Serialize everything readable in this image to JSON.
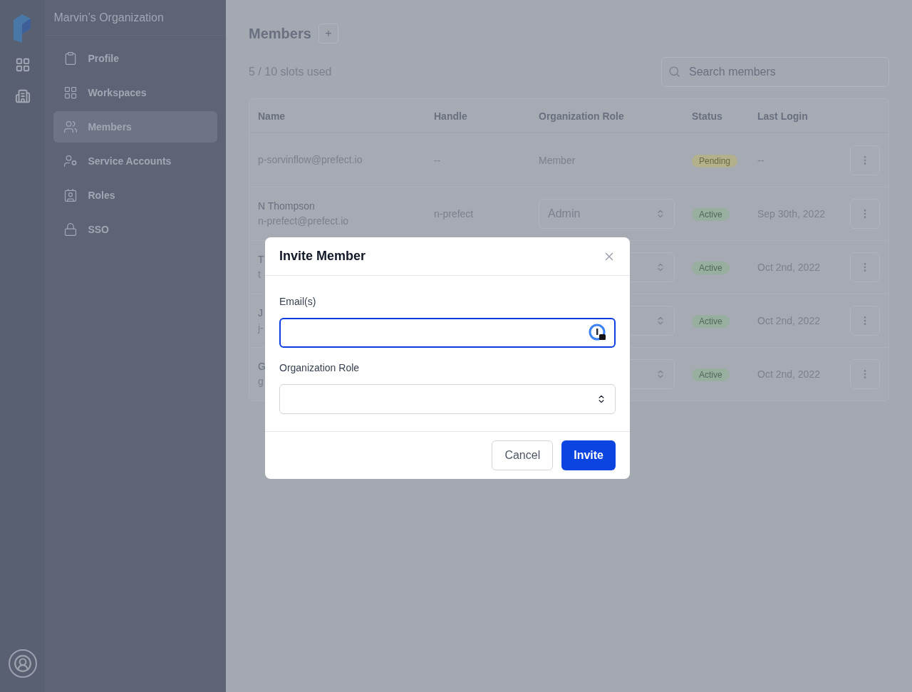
{
  "sidebar": {
    "organization": "Marvin’s Organization",
    "items": [
      {
        "label": "Profile",
        "selected": false
      },
      {
        "label": "Workspaces",
        "selected": false
      },
      {
        "label": "Members",
        "selected": true
      },
      {
        "label": "Service Accounts",
        "selected": false
      },
      {
        "label": "Roles",
        "selected": false
      },
      {
        "label": "SSO",
        "selected": false
      }
    ]
  },
  "page": {
    "title": "Members",
    "add_button": "+",
    "slots": "5 / 10 slots used",
    "search": {
      "placeholder": "Search members"
    }
  },
  "table": {
    "columns": [
      "Name",
      "Handle",
      "Organization Role",
      "Status",
      "Last Login"
    ],
    "rows": [
      {
        "name": "p-sorvinflow@prefect.io",
        "handle": "--",
        "role": {
          "kind": "text",
          "value": "Member"
        },
        "status": {
          "label": "Pending",
          "kind": "pending"
        },
        "last_login": "--"
      },
      {
        "name": "N Thompson",
        "email": "n-prefect@prefect.io",
        "handle": "n-prefect",
        "role": {
          "kind": "select",
          "value": "Admin"
        },
        "status": {
          "label": "Active",
          "kind": "active"
        },
        "last_login": "Sep 30th, 2022"
      },
      {
        "name": "T",
        "email": "t",
        "role": {
          "kind": "select"
        },
        "status": {
          "label": "Active",
          "kind": "active"
        },
        "last_login": "Oct 2nd, 2022"
      },
      {
        "name": "J",
        "email": "j-",
        "role": {
          "kind": "select"
        },
        "status": {
          "label": "Active",
          "kind": "active"
        },
        "last_login": "Oct 2nd, 2022"
      },
      {
        "name": "G",
        "email": "g",
        "role": {
          "kind": "select"
        },
        "status": {
          "label": "Active",
          "kind": "active"
        },
        "last_login": "Oct 2nd, 2022"
      }
    ]
  },
  "dialog": {
    "title": "Invite Member",
    "fields": [
      {
        "label": "Email(s)",
        "kind": "text",
        "focused": true
      },
      {
        "label": "Organization Role",
        "kind": "select",
        "focused": false
      }
    ],
    "buttons": [
      {
        "label": "Cancel",
        "kind": "secondary"
      },
      {
        "label": "Invite",
        "kind": "primary"
      }
    ]
  }
}
